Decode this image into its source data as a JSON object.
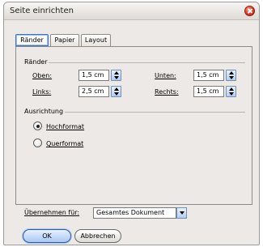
{
  "window": {
    "title": "Seite einrichten"
  },
  "tabs": [
    {
      "label": "Ränder"
    },
    {
      "label": "Papier"
    },
    {
      "label": "Layout"
    }
  ],
  "margins": {
    "group_label": "Ränder",
    "top": {
      "label": "Oben:",
      "value": "1,5 cm"
    },
    "left": {
      "label": "Links:",
      "value": "2,5 cm"
    },
    "bottom": {
      "label": "Unten:",
      "value": "1,5 cm"
    },
    "right": {
      "label": "Rechts:",
      "value": "1,5 cm"
    }
  },
  "orientation": {
    "group_label": "Ausrichtung",
    "options": [
      {
        "label": "Hochformat",
        "checked": true
      },
      {
        "label": "Querformat",
        "checked": false
      }
    ]
  },
  "apply": {
    "label": "Übernehmen für:",
    "selected": "Gesamtes Dokument"
  },
  "buttons": {
    "ok": "OK",
    "cancel": "Abbrechen"
  },
  "colors": {
    "accent": "#3a74c8",
    "close": "#d8341f"
  }
}
